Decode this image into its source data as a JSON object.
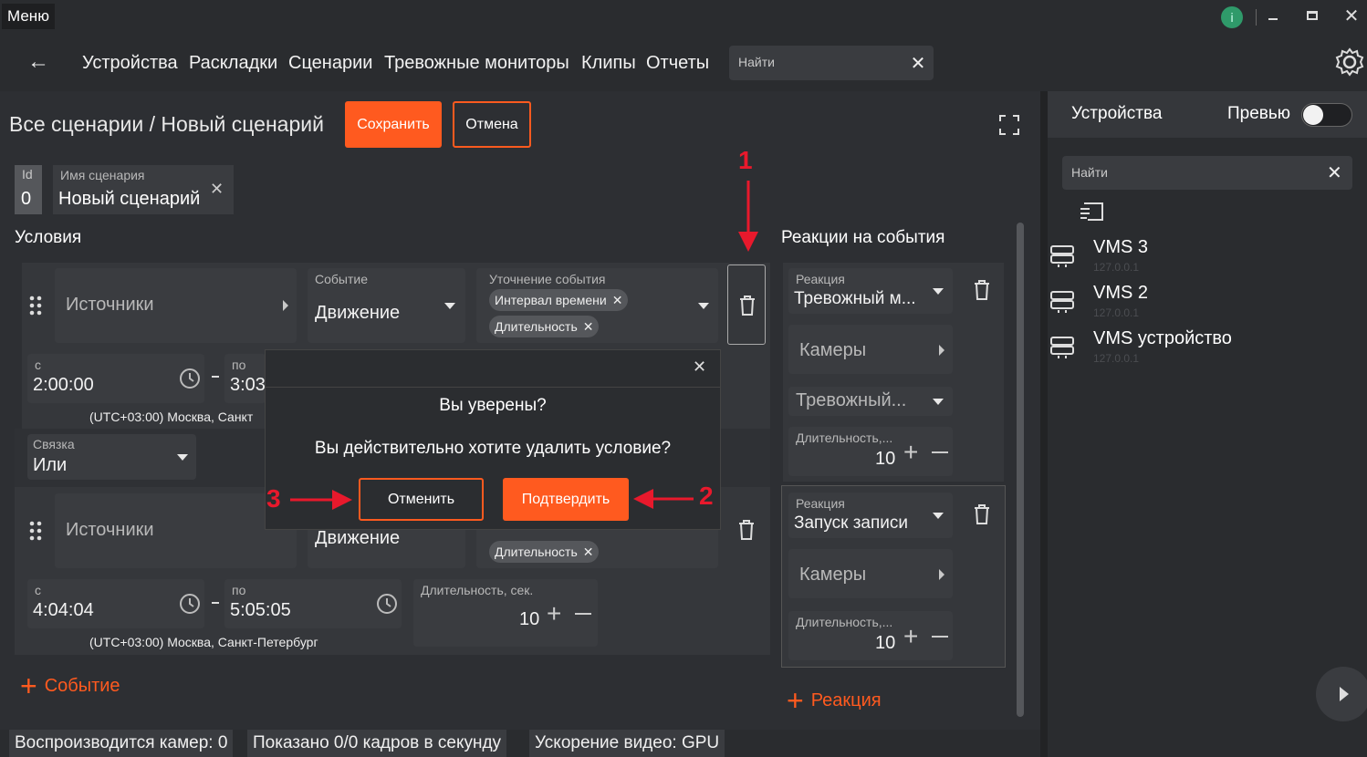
{
  "titlebar": {
    "menu_label": "Меню"
  },
  "nav": {
    "links": [
      "Устройства",
      "Раскладки",
      "Сценарии",
      "Тревожные мониторы",
      "Клипы",
      "Отчеты"
    ],
    "search_placeholder": "Найти"
  },
  "header": {
    "breadcrumb": "Все сценарии / Новый сценарий",
    "save_label": "Сохранить",
    "cancel_label": "Отмена"
  },
  "scenario": {
    "id_label": "Id",
    "id_value": "0",
    "name_label": "Имя сценария",
    "name_value": "Новый сценарий"
  },
  "conditions": {
    "title": "Условия",
    "items": [
      {
        "sources_label": "Источники",
        "event_label": "Событие",
        "event_value": "Движение",
        "refine_label": "Уточнение события",
        "chips": [
          "Интервал времени",
          "Длительность"
        ],
        "from_label": "с",
        "from_value": "2:00:00",
        "to_label": "по",
        "to_value": "3:03",
        "timezone": "(UTC+03:00) Москва, Санкт"
      },
      {
        "sources_label": "Источники",
        "event_value": "Движение",
        "chips": [
          "Длительность"
        ],
        "from_label": "с",
        "from_value": "4:04:04",
        "to_label": "по",
        "to_value": "5:05:05",
        "duration_label": "Длительность, сек.",
        "duration_value": "10",
        "timezone": "(UTC+03:00) Москва, Санкт-Петербург"
      }
    ],
    "link_label": "Связка",
    "link_value": "Или",
    "add_event_label": "Событие"
  },
  "reactions": {
    "title": "Реакции на события",
    "items": [
      {
        "reaction_label": "Реакция",
        "reaction_value": "Тревожный м...",
        "cameras_label": "Камеры",
        "extra_value": "Тревожный...",
        "duration_label": "Длительность,...",
        "duration_value": "10"
      },
      {
        "reaction_label": "Реакция",
        "reaction_value": "Запуск записи",
        "cameras_label": "Камеры",
        "duration_label": "Длительность,...",
        "duration_value": "10"
      }
    ],
    "add_reaction_label": "Реакция"
  },
  "dialog": {
    "title": "Вы уверены?",
    "message": "Вы действительно хотите удалить условие?",
    "cancel_label": "Отменить",
    "confirm_label": "Подтвердить"
  },
  "annotations": [
    "1",
    "2",
    "3"
  ],
  "side_panel": {
    "tab_devices": "Устройства",
    "preview_label": "Превью",
    "preview_on": false,
    "search_placeholder": "Найти",
    "devices": [
      {
        "name": "VMS 3",
        "ip": "127.0.0.1"
      },
      {
        "name": "VMS 2",
        "ip": "127.0.0.1"
      },
      {
        "name": "VMS устройство",
        "ip": "127.0.0.1"
      }
    ]
  },
  "status_bar": {
    "cameras": "Воспроизводится камер: 0",
    "frames": "Показано 0/0 кадров в секунду",
    "accel": "Ускорение видео: GPU"
  },
  "colors": {
    "accent": "#ff5a1f",
    "annotation": "#e8192c",
    "background": "#2a2c2f",
    "panel": "#3a3c40"
  }
}
